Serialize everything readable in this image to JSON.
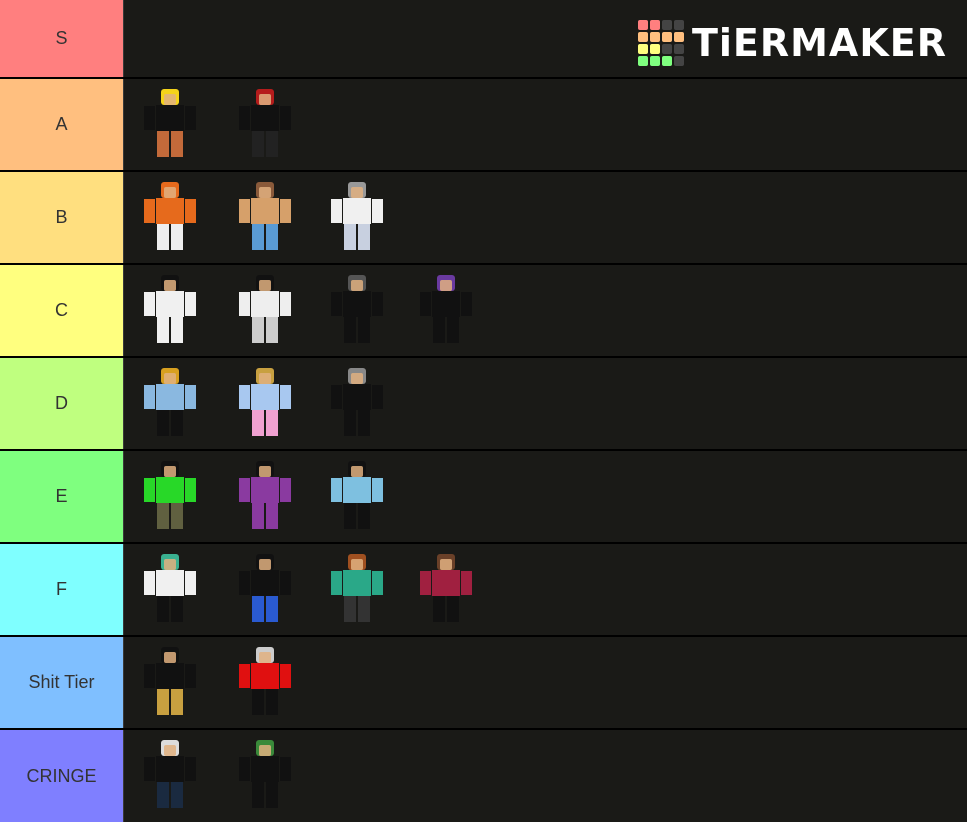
{
  "app": {
    "brand": "TiERMAKER"
  },
  "logo_grid_colors": [
    "#ff7f7f",
    "#ff7f7f",
    "#444444",
    "#444444",
    "#ffbf7f",
    "#ffbf7f",
    "#ffbf7f",
    "#ffbf7f",
    "#ffff7f",
    "#ffff7f",
    "#444444",
    "#444444",
    "#7fff7f",
    "#7fff7f",
    "#7fff7f",
    "#444444"
  ],
  "tiers": [
    {
      "label": "S",
      "color": "#ff7f7f",
      "items": []
    },
    {
      "label": "A",
      "color": "#ffbf7f",
      "items": [
        {
          "name": "pirate-noob-avatar",
          "colors": [
            "#111111",
            "#c36a3a",
            "#f5d31a"
          ]
        },
        {
          "name": "black-knife-avatar",
          "colors": [
            "#111111",
            "#222222",
            "#b51c1c"
          ]
        }
      ]
    },
    {
      "label": "B",
      "color": "#ffdf7f",
      "items": [
        {
          "name": "orange-hoodie-sword-avatar",
          "colors": [
            "#e66a1c",
            "#eeeeee",
            "#e66a1c"
          ]
        },
        {
          "name": "brown-pigtails-girl-avatar",
          "colors": [
            "#d6a06a",
            "#5a9bd4",
            "#8a5a3a"
          ]
        },
        {
          "name": "white-overalls-avatar",
          "colors": [
            "#f0f0f0",
            "#c8d0e0",
            "#999999"
          ]
        }
      ]
    },
    {
      "label": "C",
      "color": "#ffff7f",
      "items": [
        {
          "name": "bloody-shirt-avatar",
          "colors": [
            "#f0f0f0",
            "#f0f0f0",
            "#111111"
          ]
        },
        {
          "name": "black-hat-girl-avatar",
          "colors": [
            "#eeeeee",
            "#cccccc",
            "#111111"
          ]
        },
        {
          "name": "tv-head-suit-avatar",
          "colors": [
            "#111111",
            "#111111",
            "#555555"
          ]
        },
        {
          "name": "red-bandana-avatar",
          "colors": [
            "#111111",
            "#111111",
            "#6a3aa0"
          ]
        }
      ]
    },
    {
      "label": "D",
      "color": "#bfff7f",
      "items": [
        {
          "name": "straw-hat-blue-jacket-avatar",
          "colors": [
            "#8ab8e0",
            "#111111",
            "#d8a020"
          ]
        },
        {
          "name": "pastel-noob-avatar",
          "colors": [
            "#a8c8f0",
            "#f0a0d0",
            "#c8a040"
          ]
        },
        {
          "name": "red-black-racer-avatar",
          "colors": [
            "#111111",
            "#111111",
            "#888888"
          ]
        }
      ]
    },
    {
      "label": "E",
      "color": "#7fff7f",
      "items": [
        {
          "name": "green-robot-head-avatar",
          "colors": [
            "#28d828",
            "#606040",
            "#111111"
          ]
        },
        {
          "name": "purple-takis-avatar",
          "colors": [
            "#8a3aa0",
            "#8a3aa0",
            "#111111"
          ]
        },
        {
          "name": "light-blue-shirt-avatar",
          "colors": [
            "#7ec0e0",
            "#111111",
            "#111111"
          ]
        }
      ]
    },
    {
      "label": "F",
      "color": "#7fffff",
      "items": [
        {
          "name": "teal-hair-dog-shirt-avatar",
          "colors": [
            "#f0f0f0",
            "#111111",
            "#3ab090"
          ]
        },
        {
          "name": "black-mask-blue-avatar",
          "colors": [
            "#111111",
            "#2a5ad0",
            "#111111"
          ]
        },
        {
          "name": "teal-hoodie-avatar",
          "colors": [
            "#2aa888",
            "#333333",
            "#a05020"
          ]
        },
        {
          "name": "green-red-sunglasses-avatar",
          "colors": [
            "#a02040",
            "#111111",
            "#6a4028"
          ]
        }
      ]
    },
    {
      "label": "Shit Tier",
      "color": "#7fbfff",
      "items": [
        {
          "name": "black-sad-face-avatar",
          "colors": [
            "#111111",
            "#c8a040",
            "#111111"
          ]
        },
        {
          "name": "red-shirt-bandana-avatar",
          "colors": [
            "#e01010",
            "#111111",
            "#cccccc"
          ]
        }
      ]
    },
    {
      "label": "CRINGE",
      "color": "#7f7fff",
      "items": [
        {
          "name": "white-mask-black-avatar",
          "colors": [
            "#111111",
            "#1a2a40",
            "#dddddd"
          ]
        },
        {
          "name": "leaf-crown-black-avatar",
          "colors": [
            "#111111",
            "#111111",
            "#3a8a3a"
          ]
        }
      ]
    }
  ]
}
